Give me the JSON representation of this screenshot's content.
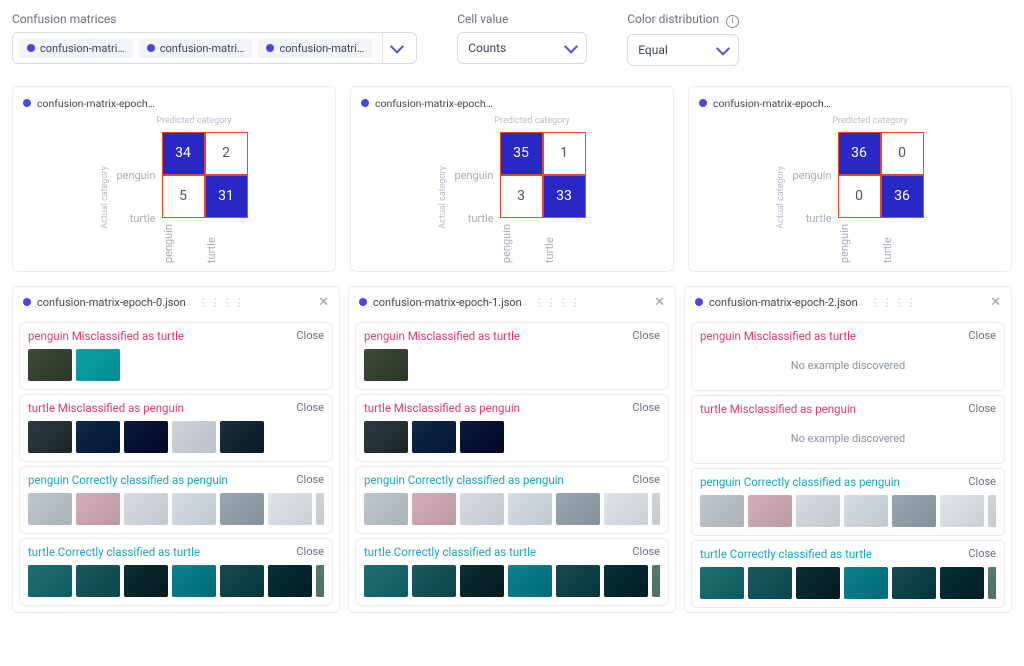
{
  "controls": {
    "matrices": {
      "label": "Confusion matrices",
      "chips": [
        "confusion-matri…",
        "confusion-matri…",
        "confusion-matri…"
      ]
    },
    "cell_value": {
      "label": "Cell value",
      "value": "Counts"
    },
    "color_dist": {
      "label": "Color distribution",
      "value": "Equal"
    }
  },
  "chart_data": [
    {
      "type": "heatmap",
      "title": "confusion-matrix-epoch…",
      "xlabel": "Predicted category",
      "ylabel": "Actual category",
      "row_labels": [
        "penguin",
        "turtle"
      ],
      "col_labels": [
        "penguin",
        "turtle"
      ],
      "values": [
        [
          34,
          2
        ],
        [
          5,
          31
        ]
      ]
    },
    {
      "type": "heatmap",
      "title": "confusion-matrix-epoch…",
      "xlabel": "Predicted category",
      "ylabel": "Actual category",
      "row_labels": [
        "penguin",
        "turtle"
      ],
      "col_labels": [
        "penguin",
        "turtle"
      ],
      "values": [
        [
          35,
          1
        ],
        [
          3,
          33
        ]
      ]
    },
    {
      "type": "heatmap",
      "title": "confusion-matrix-epoch…",
      "xlabel": "Predicted category",
      "ylabel": "Actual category",
      "row_labels": [
        "penguin",
        "turtle"
      ],
      "col_labels": [
        "penguin",
        "turtle"
      ],
      "values": [
        [
          36,
          0
        ],
        [
          0,
          36
        ]
      ]
    }
  ],
  "details": [
    {
      "file": "confusion-matrix-epoch-0.json",
      "sections": [
        {
          "type": "mis",
          "title": "penguin Misclassified as turtle",
          "close": "Close",
          "thumb_count": 2,
          "palette": "a"
        },
        {
          "type": "mis",
          "title": "turtle Misclassified as penguin",
          "close": "Close",
          "thumb_count": 5,
          "palette": "b"
        },
        {
          "type": "cor",
          "title": "penguin Correctly classified as penguin",
          "close": "Close",
          "thumb_count": 7,
          "palette": "c"
        },
        {
          "type": "cor",
          "title": "turtle Correctly classified as turtle",
          "close": "Close",
          "thumb_count": 7,
          "palette": "d"
        }
      ]
    },
    {
      "file": "confusion-matrix-epoch-1.json",
      "sections": [
        {
          "type": "mis",
          "title": "penguin Misclassified as turtle",
          "close": "Close",
          "thumb_count": 1,
          "palette": "a"
        },
        {
          "type": "mis",
          "title": "turtle Misclassified as penguin",
          "close": "Close",
          "thumb_count": 3,
          "palette": "b"
        },
        {
          "type": "cor",
          "title": "penguin Correctly classified as penguin",
          "close": "Close",
          "thumb_count": 7,
          "palette": "c"
        },
        {
          "type": "cor",
          "title": "turtle Correctly classified as turtle",
          "close": "Close",
          "thumb_count": 7,
          "palette": "d"
        }
      ]
    },
    {
      "file": "confusion-matrix-epoch-2.json",
      "sections": [
        {
          "type": "mis",
          "title": "penguin Misclassified as turtle",
          "close": "Close",
          "empty": "No example discovered"
        },
        {
          "type": "mis",
          "title": "turtle Misclassified as penguin",
          "close": "Close",
          "empty": "No example discovered"
        },
        {
          "type": "cor",
          "title": "penguin Correctly classified as penguin",
          "close": "Close",
          "thumb_count": 7,
          "palette": "c"
        },
        {
          "type": "cor",
          "title": "turtle Correctly classified as turtle",
          "close": "Close",
          "thumb_count": 7,
          "palette": "d"
        }
      ]
    }
  ],
  "palettes": {
    "a": [
      "#3d4a3a",
      "#0da0a6",
      "#5a7a6e",
      "#2b6e7a",
      "#7db0b8"
    ],
    "b": [
      "#2d3b3e",
      "#102a4a",
      "#0b1b3a",
      "#cfd4da",
      "#1b2f3a",
      "#203a30",
      "#2a4a50"
    ],
    "c": [
      "#bfc7cd",
      "#cfaeb7",
      "#d6dce2",
      "#d6dde2",
      "#9aa6af",
      "#dfe4e8",
      "#d0d5da"
    ],
    "d": [
      "#1f6f73",
      "#1b5a5e",
      "#0e2f34",
      "#0f7f8c",
      "#174a50",
      "#093038",
      "#5a7a6e"
    ]
  }
}
